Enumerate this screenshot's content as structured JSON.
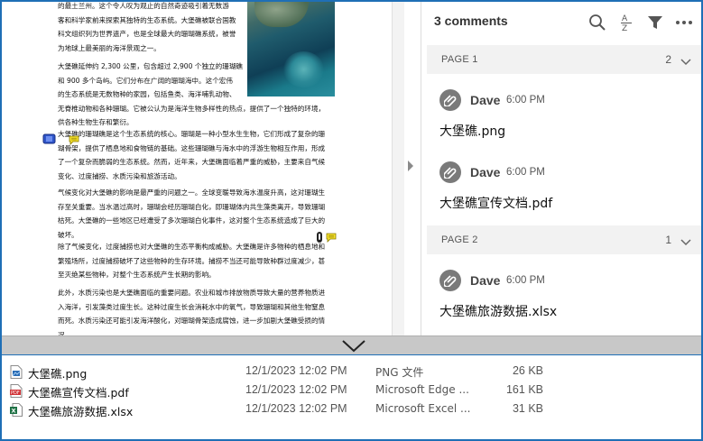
{
  "document": {
    "paragraphs": [
      [
        "的最土兰州。这个令人叹为观止的自然奇迹吸引着无数游",
        "客和科学家前来探索其独特的生态系统。大堡礁被联合国教",
        "科文组织列为世界遗产，也是全球最大的珊瑚礁系统，被誉",
        "为地球上最美丽的海洋景观之一。"
      ],
      [
        "大堡礁延伸约 2,300 公里，包含超过 2,900 个独立的珊瑚礁",
        "和 900 多个岛屿。它们分布在广阔的珊瑚海中。这个宏伟",
        "的生态系统是无数物种的家园，包括鱼类、海洋哺乳动物、",
        "无脊椎动物和各种珊瑚。它被公认为是海洋生物多样性的热点，提供了一个独特的环境，",
        "供各种生物生存和繁衍。"
      ],
      [
        "大堡礁的珊瑚礁是这个生态系统的核心。珊瑚是一种小型水生生物，它们形成了复杂的珊",
        "瑚骨架，提供了栖息地和食物链的基础。这些珊瑚礁与海水中的浮游生物相互作用，形成",
        "了一个复杂而脆弱的生态系统。然而，近年来，大堡礁面临着严重的威胁，主要来自气候",
        "变化、过度捕捞、水质污染和旅游活动。"
      ],
      [
        "气候变化对大堡礁的影响是最严重的问题之一。全球变暖导致海水温度升高，这对珊瑚生",
        "存至关重要。当水温过高时，珊瑚会经历珊瑚白化，即珊瑚体内共生藻类离开，导致珊瑚",
        "枯死。大堡礁的一些地区已经遭受了多次珊瑚白化事件，这对整个生态系统造成了巨大的",
        "破坏。"
      ],
      [
        "除了气候变化，过度捕捞也对大堡礁的生态平衡构成威胁。大堡礁是许多物种的栖息地和",
        "繁殖场所，过度捕捞破坏了这些物种的生存环境。捕捞不当还可能导致种群过度减少，甚",
        "至灭绝某些物种，对整个生态系统产生长期的影响。"
      ],
      [
        "此外，水质污染也是大堡礁面临的重要问题。农业和城市排放物质导致大量的营养物质进",
        "入海洋，引发藻类过度生长。这种过度生长会消耗水中的氧气，导致珊瑚和其他生物窒息",
        "而死。水质污染还可能引发海洋酸化，对珊瑚骨架造成腐蚀，进一步加剧大堡礁受损的情",
        "况。"
      ]
    ]
  },
  "comments": {
    "title": "3 comments",
    "toolbar": {
      "search_icon": "search-icon",
      "sort_icon": "sort-az-icon",
      "filter_icon": "filter-icon",
      "more_icon": "more-icon"
    },
    "groups": [
      {
        "page_label": "PAGE 1",
        "count": "2",
        "items": [
          {
            "author": "Dave",
            "time": "6:00 PM",
            "text": "大堡礁.png"
          },
          {
            "author": "Dave",
            "time": "6:00 PM",
            "text": "大堡礁宣传文档.pdf"
          }
        ]
      },
      {
        "page_label": "PAGE 2",
        "count": "1",
        "items": [
          {
            "author": "Dave",
            "time": "6:00 PM",
            "text": "大堡礁旅游数据.xlsx"
          }
        ]
      }
    ]
  },
  "files": [
    {
      "name": "大堡礁.png",
      "date": "12/1/2023 12:02 PM",
      "type": "PNG 文件",
      "size": "26 KB",
      "icon": "image-file-icon",
      "color": "#2a6db5"
    },
    {
      "name": "大堡礁宣传文档.pdf",
      "date": "12/1/2023 12:02 PM",
      "type": "Microsoft Edge ...",
      "size": "161 KB",
      "icon": "pdf-file-icon",
      "color": "#d13438"
    },
    {
      "name": "大堡礁旅游数据.xlsx",
      "date": "12/1/2023 12:02 PM",
      "type": "Microsoft Excel ...",
      "size": "31 KB",
      "icon": "excel-file-icon",
      "color": "#1e7145"
    }
  ],
  "colors": {
    "accent": "#1f6fb6",
    "avatar": "#7a7a7a",
    "note": "#f5e12c"
  }
}
